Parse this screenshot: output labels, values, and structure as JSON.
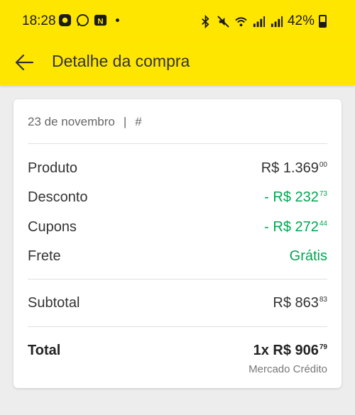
{
  "status_bar": {
    "time": "18:28",
    "battery": "42%"
  },
  "header": {
    "title": "Detalhe da compra"
  },
  "purchase": {
    "date": "23 de novembro",
    "separator": "|",
    "id": "#"
  },
  "rows": [
    {
      "label": "Produto",
      "int": "R$ 1.369",
      "cents": "00"
    },
    {
      "label": "Desconto",
      "int": "- R$ 232",
      "cents": "73"
    },
    {
      "label": "Cupons",
      "int": "- R$ 272",
      "cents": "44"
    },
    {
      "label": "Frete",
      "int": "Grátis",
      "cents": ""
    }
  ],
  "subtotal": {
    "label": "Subtotal",
    "int": "R$ 863",
    "cents": "83"
  },
  "total": {
    "label": "Total",
    "int": "1x R$ 906",
    "cents": "79",
    "method": "Mercado Crédito"
  },
  "colors": {
    "brand_yellow": "#ffe600",
    "discount_green": "#00a650"
  }
}
